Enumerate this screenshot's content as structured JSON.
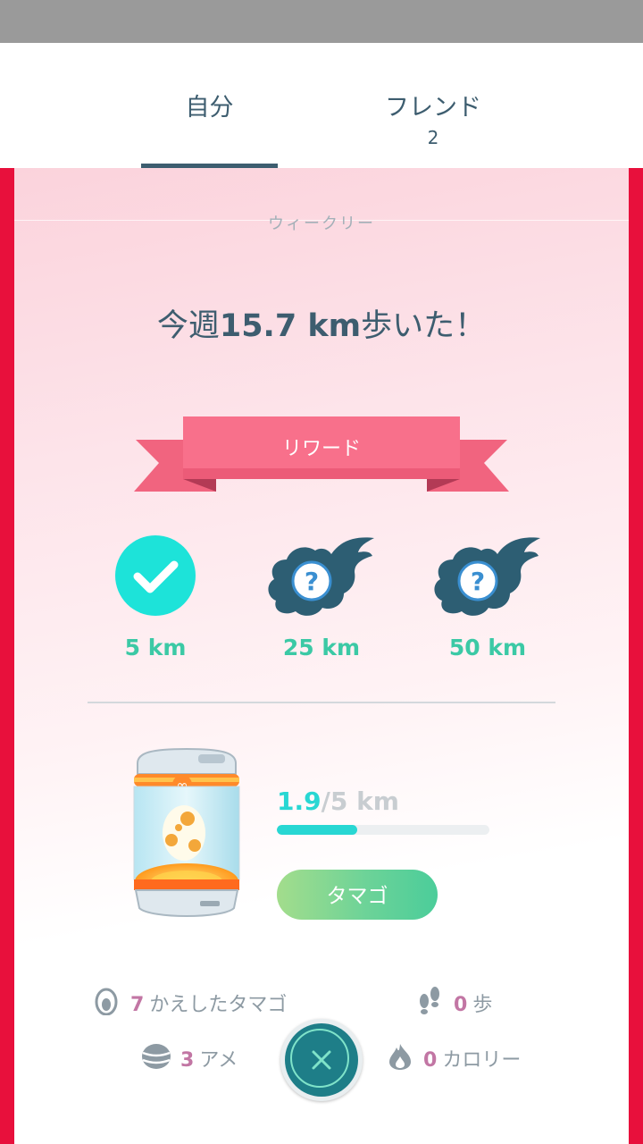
{
  "tabs": [
    {
      "label": "自分"
    },
    {
      "label": "フレンド",
      "count": "2"
    }
  ],
  "weekly": {
    "label": "ウィークリー",
    "headline_prefix": "今週",
    "headline_value": "15.7 km",
    "headline_suffix": "歩いた！"
  },
  "rewards": {
    "ribbon_label": "リワード",
    "items": [
      {
        "km": "5 km",
        "icon": "check-icon",
        "status": "achieved"
      },
      {
        "km": "25 km",
        "icon": "mystery-reward-icon",
        "status": "locked"
      },
      {
        "km": "50 km",
        "icon": "mystery-reward-icon",
        "status": "locked"
      }
    ]
  },
  "egg": {
    "walked": "1.9",
    "total": "/5 km",
    "progress_fraction": 0.38,
    "button_label": "タマゴ",
    "icon": "incubator-icon"
  },
  "stats": {
    "hatched": {
      "value": "7",
      "label": "かえしたタマゴ",
      "icon": "egg-icon"
    },
    "steps": {
      "value": "0",
      "label": "歩",
      "icon": "footprints-icon"
    },
    "candy": {
      "value": "3",
      "label": "アメ",
      "icon": "candy-icon"
    },
    "calories": {
      "value": "0",
      "label": "カロリー",
      "icon": "flame-icon"
    }
  },
  "colors": {
    "accent_teal": "#28d7d3",
    "frame_red": "#e8103c",
    "ribbon_pink": "#f4617e",
    "text_dark": "#3d5d6f",
    "km_green": "#3bc9a5"
  }
}
